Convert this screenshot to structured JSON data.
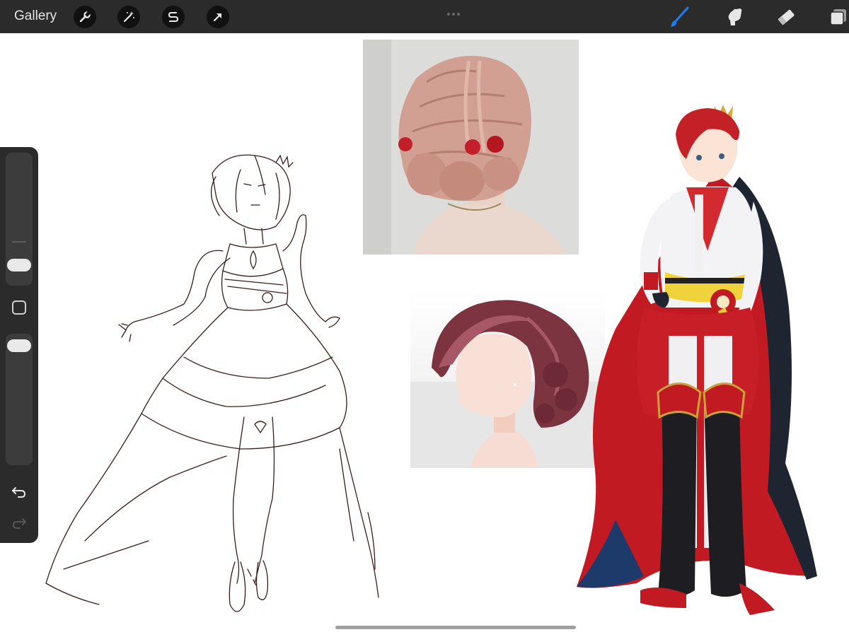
{
  "toolbar": {
    "gallery_label": "Gallery",
    "left_tools": [
      "wrench-icon",
      "magic-wand-icon",
      "selection-icon",
      "arrow-icon"
    ],
    "right_tools": [
      "brush-icon",
      "smudge-icon",
      "eraser-icon",
      "layers-icon"
    ],
    "active_tool": "brush-icon",
    "active_color": "#1a7ff0"
  },
  "sidebar": {
    "size_slider_level": 0.27,
    "opacity_slider_level": 0.05,
    "controls": [
      "modify-button",
      "undo-icon",
      "redo-icon"
    ]
  },
  "canvas": {
    "background": "#ffffff",
    "items": [
      "character-sketch",
      "hairstyle-photo-reference",
      "hairstyle-illustration-reference",
      "character-color-reference"
    ]
  }
}
